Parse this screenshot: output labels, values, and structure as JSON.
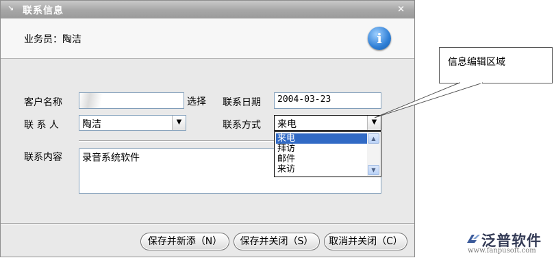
{
  "window": {
    "title": "联系信息",
    "close_glyph": "×",
    "title_icon": "collapse-icon"
  },
  "header": {
    "staff_label": "业务员：",
    "staff_name": "陶洁",
    "info_icon_glyph": "i"
  },
  "form": {
    "customer_label": "客户名称",
    "customer_value": "",
    "select_label": "选择",
    "date_label": "联系日期",
    "date_value": "2004-03-23",
    "contact_label": "联 系 人",
    "contact_value": "陶洁",
    "method_label": "联系方式",
    "method_value": "来电",
    "method_options": [
      "来电",
      "拜访",
      "邮件",
      "来访"
    ],
    "method_selected_index": 0,
    "content_label": "联系内容",
    "content_value": "录音系统软件"
  },
  "buttons": {
    "save_new": "保存并新添（N）",
    "save_close": "保存并关闭（S）",
    "cancel_close": "取消并关闭（C）"
  },
  "annotation": {
    "text": "信息编辑区域"
  },
  "logo": {
    "name": "泛普软件",
    "url": "www.fanpusoft.com"
  },
  "colors": {
    "selection": "#316ac5",
    "titlebar": "#a6a6a6",
    "logo_mark": "#3b5a9a"
  }
}
